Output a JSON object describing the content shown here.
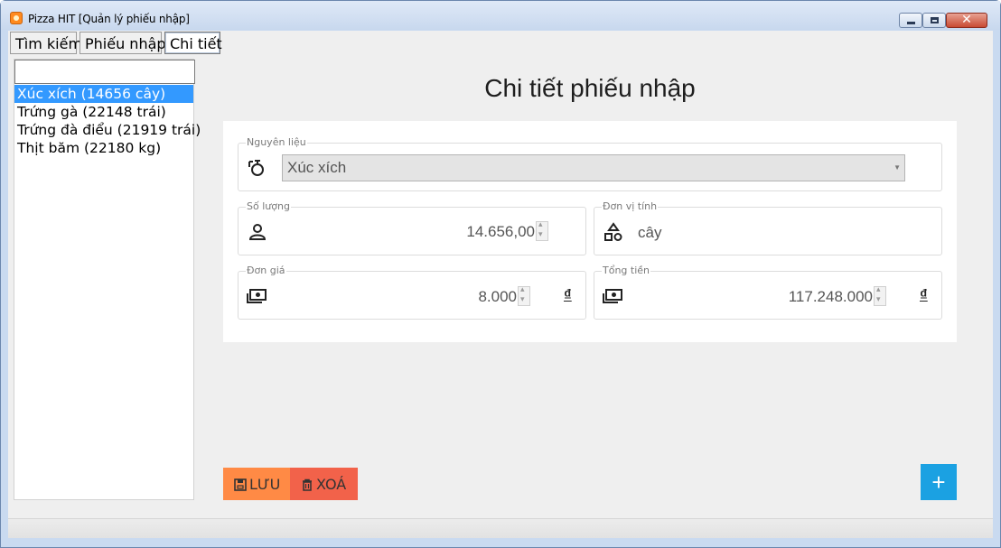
{
  "window": {
    "title": "Pizza HIT [Quản lý phiếu nhập]",
    "close_glyph": "✕"
  },
  "tabs": [
    {
      "label": "Tìm kiếm"
    },
    {
      "label": "Phiếu nhập"
    },
    {
      "label": "Chi tiết",
      "active": true
    }
  ],
  "sidebar": {
    "search_value": "",
    "items": [
      {
        "label": "Xúc xích (14656 cây)",
        "selected": true
      },
      {
        "label": "Trứng gà (22148 trái)"
      },
      {
        "label": "Trứng đà điểu (21919 trái)"
      },
      {
        "label": "Thịt băm (22180 kg)"
      }
    ]
  },
  "main": {
    "title": "Chi tiết phiếu nhập",
    "ingredient": {
      "label": "Nguyên liệu",
      "value": "Xúc xích"
    },
    "quantity": {
      "label": "Số lượng",
      "value": "14.656,00"
    },
    "unit": {
      "label": "Đơn vị tính",
      "value": "cây"
    },
    "unit_price": {
      "label": "Đơn giá",
      "value": "8.000",
      "currency": "₫"
    },
    "total": {
      "label": "Tổng tiền",
      "value": "117.248.000",
      "currency": "₫"
    }
  },
  "actions": {
    "save_label": "LƯU",
    "delete_label": "XOÁ",
    "add_label": "+"
  },
  "colors": {
    "save": "#ff8a45",
    "delete": "#f2624a",
    "add": "#1ba1e2",
    "selected_item": "#3399ff"
  }
}
